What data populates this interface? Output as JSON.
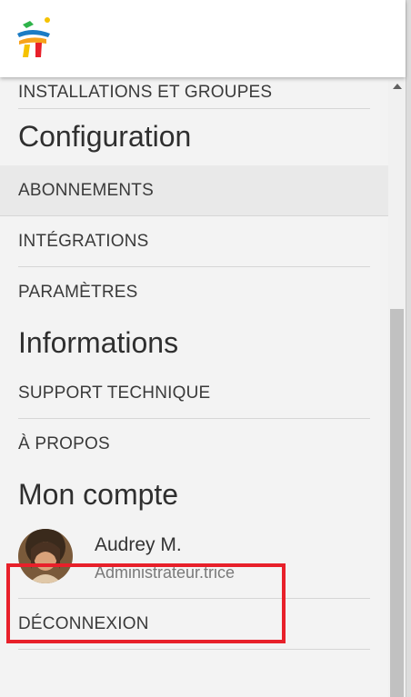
{
  "menu": {
    "installations": "INSTALLATIONS ET GROUPES",
    "configuration_heading": "Configuration",
    "abonnements": "ABONNEMENTS",
    "integrations": "INTÉGRATIONS",
    "parametres": "PARAMÈTRES",
    "informations_heading": "Informations",
    "support": "SUPPORT TECHNIQUE",
    "apropos": "À PROPOS",
    "compte_heading": "Mon compte",
    "deconnexion": "DÉCONNEXION"
  },
  "user": {
    "name": "Audrey M.",
    "role": "Administrateur.trice"
  },
  "icons": {
    "logo": "app-logo-icon",
    "avatar": "user-avatar"
  },
  "colors": {
    "highlight": "#e8202a",
    "menu_bg": "#f3f3f3",
    "active_bg": "#e9e9e9"
  }
}
